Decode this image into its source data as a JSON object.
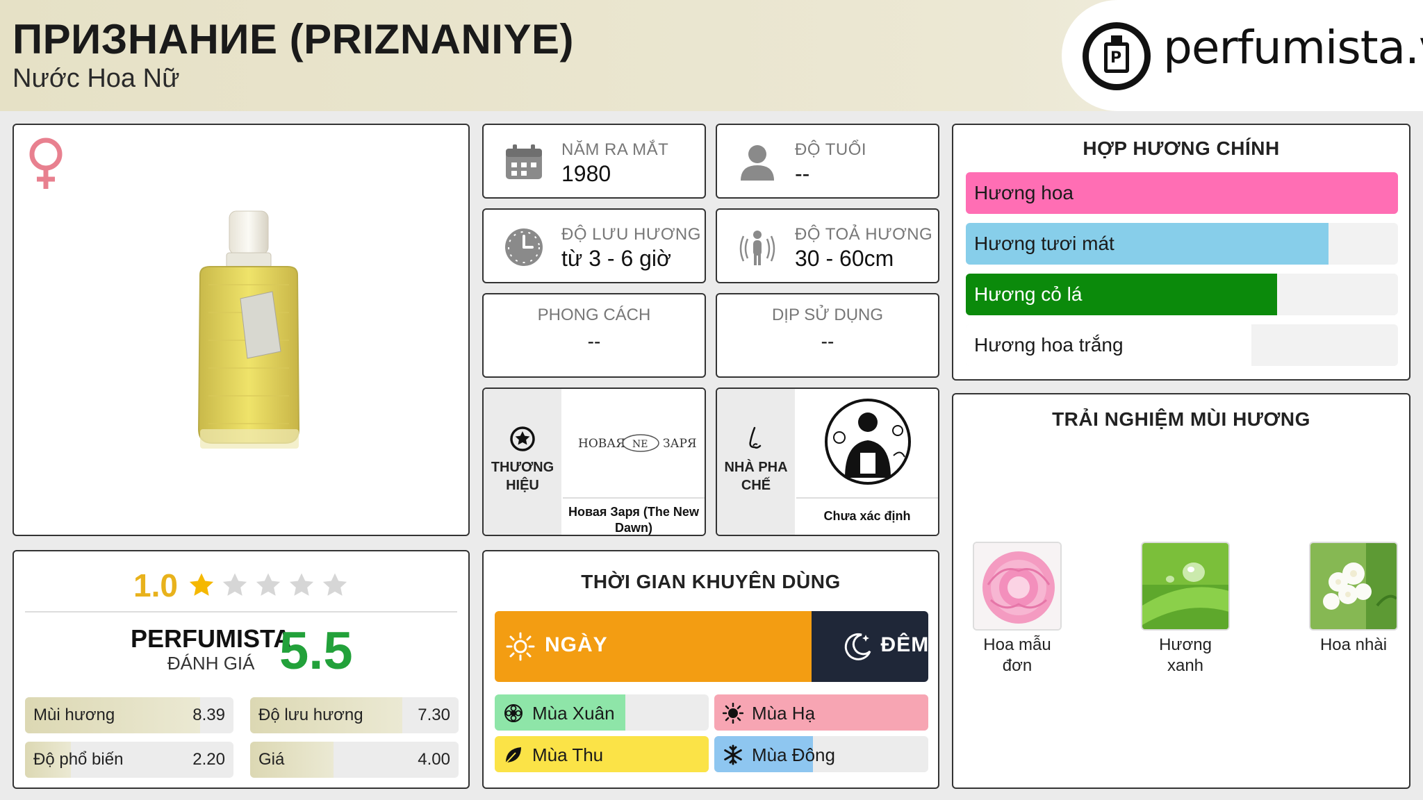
{
  "header": {
    "title": "ПРИЗНАНИЕ (PRIZNANIYE)",
    "subtitle": "Nước Hoa Nữ",
    "logo_text": "perfumista.vn"
  },
  "product": {
    "gender_icon": "venus-icon"
  },
  "rating": {
    "score": "1.0",
    "stars_filled": 1,
    "stars_total": 5,
    "perfumista_label": "PERFUMISTA",
    "perfumista_sub": "ĐÁNH GIÁ",
    "perfumista_score": "5.5",
    "metrics": [
      {
        "label": "Mùi hương",
        "value": "8.39"
      },
      {
        "label": "Độ lưu hương",
        "value": "7.30"
      },
      {
        "label": "Độ phổ biến",
        "value": "2.20"
      },
      {
        "label": "Giá",
        "value": "4.00"
      }
    ]
  },
  "info": {
    "release_year": {
      "label": "NĂM RA MẮT",
      "value": "1980"
    },
    "age": {
      "label": "ĐỘ TUỔI",
      "value": "--"
    },
    "longevity": {
      "label": "ĐỘ LƯU HƯƠNG",
      "value": "từ 3 - 6 giờ"
    },
    "sillage": {
      "label": "ĐỘ TOẢ HƯƠNG",
      "value": "30 - 60cm"
    },
    "style": {
      "label": "PHONG CÁCH",
      "value": "--"
    },
    "occasion": {
      "label": "DỊP SỬ DỤNG",
      "value": "--"
    }
  },
  "brand": {
    "tab_label": "THƯƠNG HIỆU",
    "logo_text_left": "НОВАЯ",
    "logo_text_mid": "NE",
    "logo_text_right": "ЗАРЯ",
    "name": "Новая Заря (The New Dawn)"
  },
  "perfumer": {
    "tab_label": "NHÀ PHA CHẾ",
    "name": "Chưa xác định"
  },
  "accords": {
    "title": "HỢP HƯƠNG CHÍNH",
    "items": [
      {
        "label": "Hương hoa",
        "percent": 100,
        "color": "#ff6eb4"
      },
      {
        "label": "Hương tươi mát",
        "percent": 84,
        "color": "#87ceea"
      },
      {
        "label": "Hương cỏ lá",
        "percent": 72,
        "color": "#0b8a0b"
      },
      {
        "label": "Hương hoa trắng",
        "percent": 66,
        "color": "#ffffff"
      }
    ]
  },
  "recommended": {
    "title": "THỜI GIAN KHUYÊN DÙNG",
    "day_label": "NGÀY",
    "night_label": "ĐÊM",
    "day_percent": 73,
    "seasons": [
      {
        "label": "Mùa Xuân",
        "percent": 61,
        "color": "#8ee5a8"
      },
      {
        "label": "Mùa Hạ",
        "percent": 100,
        "color": "#f7a5b3"
      },
      {
        "label": "Mùa Thu",
        "percent": 100,
        "color": "#fbe347"
      },
      {
        "label": "Mùa Đông",
        "percent": 46,
        "color": "#8ec6f0"
      }
    ]
  },
  "experience": {
    "title": "TRẢI NGHIỆM MÙI HƯƠNG",
    "notes": [
      {
        "name": "Hoa mẫu đơn"
      },
      {
        "name": "Hương xanh"
      },
      {
        "name": "Hoa nhài"
      }
    ]
  },
  "colors": {
    "star_gold": "#f5b800",
    "star_gray": "#d6d6d6",
    "score_green": "#22a13a",
    "venus": "#e8808f"
  }
}
